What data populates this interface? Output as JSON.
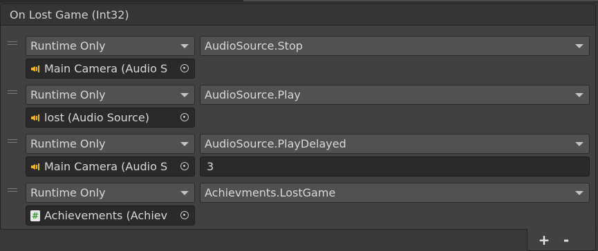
{
  "event": {
    "title": "On Lost Game (Int32)"
  },
  "entries": [
    {
      "mode": "Runtime Only",
      "target": "Main Camera (Audio S",
      "target_icon": "speaker-icon",
      "function": "AudioSource.Stop",
      "argument": null
    },
    {
      "mode": "Runtime Only",
      "target": "lost (Audio Source)",
      "target_icon": "speaker-icon",
      "function": "AudioSource.Play",
      "argument": null
    },
    {
      "mode": "Runtime Only",
      "target": "Main Camera (Audio S",
      "target_icon": "speaker-icon",
      "function": "AudioSource.PlayDelayed",
      "argument": "3"
    },
    {
      "mode": "Runtime Only",
      "target": "Achievements (Achiev",
      "target_icon": "script-icon",
      "function": "Achievments.LostGame",
      "argument": null
    }
  ],
  "footer": {
    "add_label": "+",
    "remove_label": "-"
  },
  "colors": {
    "background": "#383838",
    "panel": "#414141",
    "header": "#353535",
    "dropdown": "#515151",
    "field": "#2a2a2a",
    "audio_icon": "#f0b41e",
    "script_icon": "#3f9a3a"
  }
}
